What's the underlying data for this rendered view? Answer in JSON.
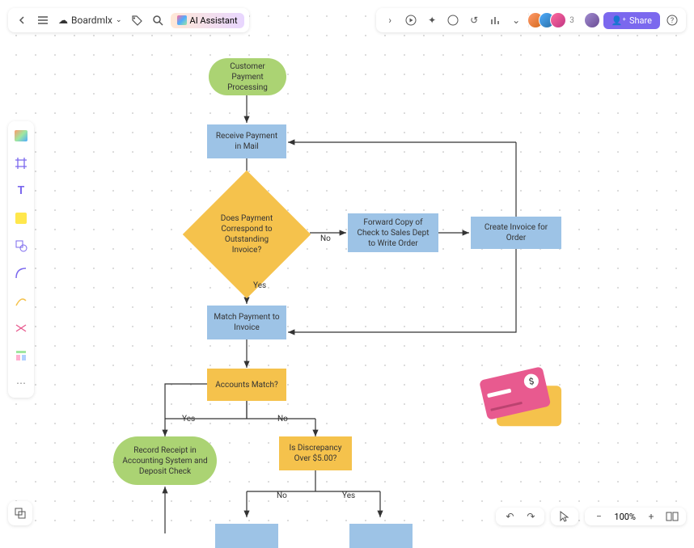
{
  "header": {
    "board_name": "Boardmlx",
    "ai_label": "AI Assistant",
    "share_label": "Share",
    "avatar_extra": "3"
  },
  "zoom": {
    "level": "100%"
  },
  "flowchart": {
    "nodes": {
      "start": "Customer Payment Processing",
      "receive": "Receive Payment in Mail",
      "correspond": "Does Payment Correspond to Outstanding Invoice?",
      "forward": "Forward Copy of Check to Sales Dept to Write Order",
      "create_invoice": "Create Invoice for Order",
      "match": "Match Payment to Invoice",
      "accounts_match": "Accounts Match?",
      "record": "Record Receipt in Accounting System and Deposit Check",
      "discrepancy": "Is Discrepancy Over $5.00?"
    },
    "labels": {
      "yes": "Yes",
      "no": "No"
    }
  },
  "chart_data": {
    "type": "flowchart",
    "title": "Customer Payment Processing",
    "nodes": [
      {
        "id": "start",
        "type": "terminator",
        "label": "Customer Payment Processing"
      },
      {
        "id": "receive",
        "type": "process",
        "label": "Receive Payment in Mail"
      },
      {
        "id": "correspond",
        "type": "decision",
        "label": "Does Payment Correspond to Outstanding Invoice?"
      },
      {
        "id": "forward",
        "type": "process",
        "label": "Forward Copy of Check to Sales Dept to Write Order"
      },
      {
        "id": "create_invoice",
        "type": "process",
        "label": "Create Invoice for Order"
      },
      {
        "id": "match",
        "type": "process",
        "label": "Match Payment to Invoice"
      },
      {
        "id": "accounts_match",
        "type": "decision",
        "label": "Accounts Match?"
      },
      {
        "id": "record",
        "type": "terminator",
        "label": "Record Receipt in Accounting System and Deposit Check"
      },
      {
        "id": "discrepancy",
        "type": "decision",
        "label": "Is Discrepancy Over $5.00?"
      }
    ],
    "edges": [
      {
        "from": "start",
        "to": "receive"
      },
      {
        "from": "receive",
        "to": "correspond"
      },
      {
        "from": "correspond",
        "to": "forward",
        "label": "No"
      },
      {
        "from": "forward",
        "to": "create_invoice"
      },
      {
        "from": "create_invoice",
        "to": "match"
      },
      {
        "from": "correspond",
        "to": "match",
        "label": "Yes"
      },
      {
        "from": "match",
        "to": "accounts_match"
      },
      {
        "from": "accounts_match",
        "to": "record",
        "label": "Yes"
      },
      {
        "from": "accounts_match",
        "to": "discrepancy",
        "label": "No"
      },
      {
        "from": "discrepancy",
        "to": "?",
        "label": "No"
      },
      {
        "from": "discrepancy",
        "to": "?",
        "label": "Yes"
      }
    ]
  }
}
